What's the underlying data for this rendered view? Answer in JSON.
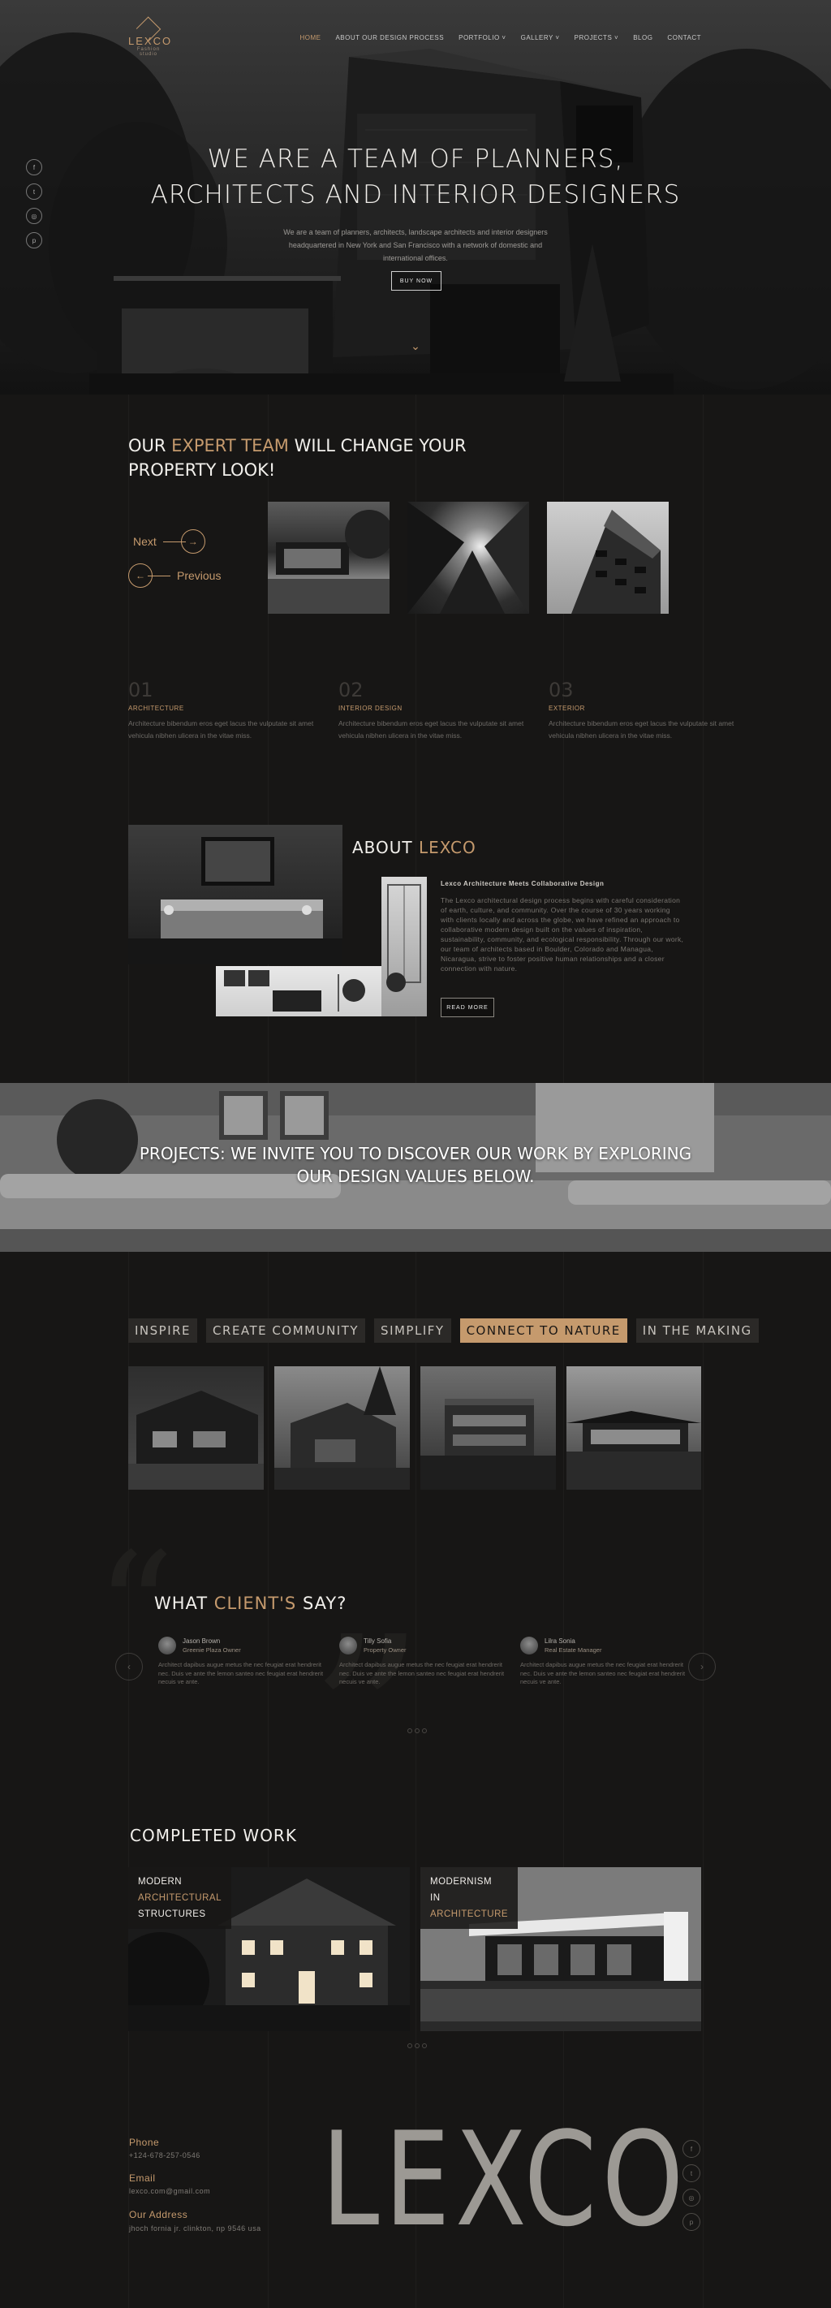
{
  "header": {
    "logo_title": "LEXCO",
    "logo_subtitle": "Fashion studio",
    "nav": [
      "HOME",
      "ABOUT OUR DESIGN PROCESS",
      "PORTFOLIO ˅",
      "GALLERY ˅",
      "PROJECTS ˅",
      "BLOG",
      "CONTACT"
    ],
    "social_icons": [
      "facebook-icon",
      "twitter-icon",
      "instagram-icon",
      "pinterest-icon"
    ]
  },
  "hero": {
    "title_line1": "WE ARE A TEAM OF PLANNERS,",
    "title_line2": "ARCHITECTS AND INTERIOR DESIGNERS",
    "description": "We are a team of planners, architects, landscape architects and interior designers headquartered in New York and San Francisco with a network of domestic and international offices.",
    "button": "BUY NOW"
  },
  "expert": {
    "title_part1": "OUR ",
    "title_accent": "EXPERT TEAM",
    "title_part2": " WILL CHANGE YOUR",
    "title_line2": "PROPERTY LOOK!",
    "next": "Next",
    "previous": "Previous"
  },
  "services": [
    {
      "num": "01",
      "title": "ARCHITECTURE",
      "text": "Architecture bibendum eros eget lacus the vulputate sit amet vehicula nibhen ulicera in the vitae miss."
    },
    {
      "num": "02",
      "title": "INTERIOR DESIGN",
      "text": "Architecture bibendum eros eget lacus the vulputate sit amet vehicula nibhen ulicera in the vitae miss."
    },
    {
      "num": "03",
      "title": "EXTERIOR",
      "text": "Architecture bibendum eros eget lacus the vulputate sit amet vehicula nibhen ulicera in the vitae miss."
    }
  ],
  "about": {
    "title": "ABOUT ",
    "title_accent": "LEXCO",
    "subtitle": "Lexco Architecture Meets Collaborative Design",
    "text": "The Lexco architectural design process begins with careful consideration of earth, culture, and community. Over the course of 30 years working with clients locally and across the globe, we have refined an approach to collaborative modern design built on the values of inspiration, sustainability, community, and ecological responsibility. Through our work, our team of architects based in Boulder, Colorado and Managua, Nicaragua, strive to foster positive human relationships and a closer connection with nature.",
    "button": "READ MORE"
  },
  "projects_banner": {
    "line1": "PROJECTS: WE INVITE YOU TO DISCOVER OUR WORK BY EXPLORING",
    "line2": "OUR DESIGN VALUES BELOW."
  },
  "tabs": [
    {
      "label": "INSPIRE",
      "active": false
    },
    {
      "label": "CREATE COMMUNITY",
      "active": false
    },
    {
      "label": "SIMPLIFY",
      "active": false
    },
    {
      "label": "CONNECT TO NATURE",
      "active": true
    },
    {
      "label": "IN THE MAKING",
      "active": false
    }
  ],
  "testimonials": {
    "title": "WHAT ",
    "title_accent": "CLIENT'S",
    "title_end": " SAY?",
    "items": [
      {
        "name": "Jason Brown",
        "role": "Greenie Plaza Owner",
        "text": "Architect dapibus augue metus the nec feugiat erat hendrerit nec. Duis ve ante the lemon santeo nec feugiat erat hendrerit necuis ve ante."
      },
      {
        "name": "Tilly Sofia",
        "role": "Property Owner",
        "text": "Architect dapibus augue metus the nec feugiat erat hendrerit nec. Duis ve ante the lemon santeo nec feugiat erat hendrerit necuis ve ante."
      },
      {
        "name": "Lilra Sonia",
        "role": "Real Estate Manager",
        "text": "Architect dapibus augue metus the nec feugiat erat hendrerit nec. Duis ve ante the lemon santeo nec feugiat erat hendrerit necuis ve ante."
      }
    ]
  },
  "completed": {
    "title": "COMPLETED WORK",
    "cards": [
      {
        "line1": "MODERN",
        "line2": "ARCHITECTURAL",
        "line3": "STRUCTURES"
      },
      {
        "line1": "MODERNISM",
        "line2": "IN",
        "line3": "ARCHITECTURE"
      }
    ]
  },
  "footer": {
    "phone_label": "Phone",
    "phone": "+124-678-257-0546",
    "email_label": "Email",
    "email": "lexco.com@gmail.com",
    "address_label": "Our Address",
    "address": "jhoch fornia jr. clinkton, np 9546 usa",
    "big_logo": "LEXCO",
    "social_icons": [
      "facebook-icon",
      "twitter-icon",
      "instagram-icon",
      "pinterest-icon"
    ]
  },
  "colors": {
    "background": "#171615",
    "accent": "#c59a6d"
  }
}
